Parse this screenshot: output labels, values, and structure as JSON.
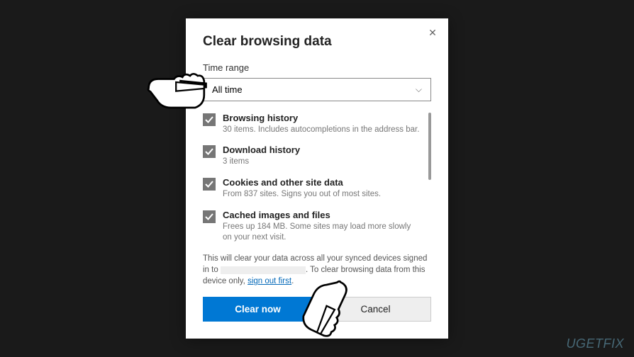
{
  "dialog": {
    "title": "Clear browsing data",
    "time_range_label": "Time range",
    "time_range_value": "All time",
    "items": [
      {
        "title": "Browsing history",
        "desc": "30 items. Includes autocompletions in the address bar."
      },
      {
        "title": "Download history",
        "desc": "3 items"
      },
      {
        "title": "Cookies and other site data",
        "desc": "From 837 sites. Signs you out of most sites."
      },
      {
        "title": "Cached images and files",
        "desc": "Frees up 184 MB. Some sites may load more slowly on your next visit."
      }
    ],
    "sync_text_1": "This will clear your data across all your synced devices signed in to",
    "sync_text_2": ". To clear browsing data from this device only, ",
    "sign_out_link": "sign out first",
    "sync_text_3": ".",
    "clear_button": "Clear now",
    "cancel_button": "Cancel"
  },
  "watermark": "UGETFIX"
}
